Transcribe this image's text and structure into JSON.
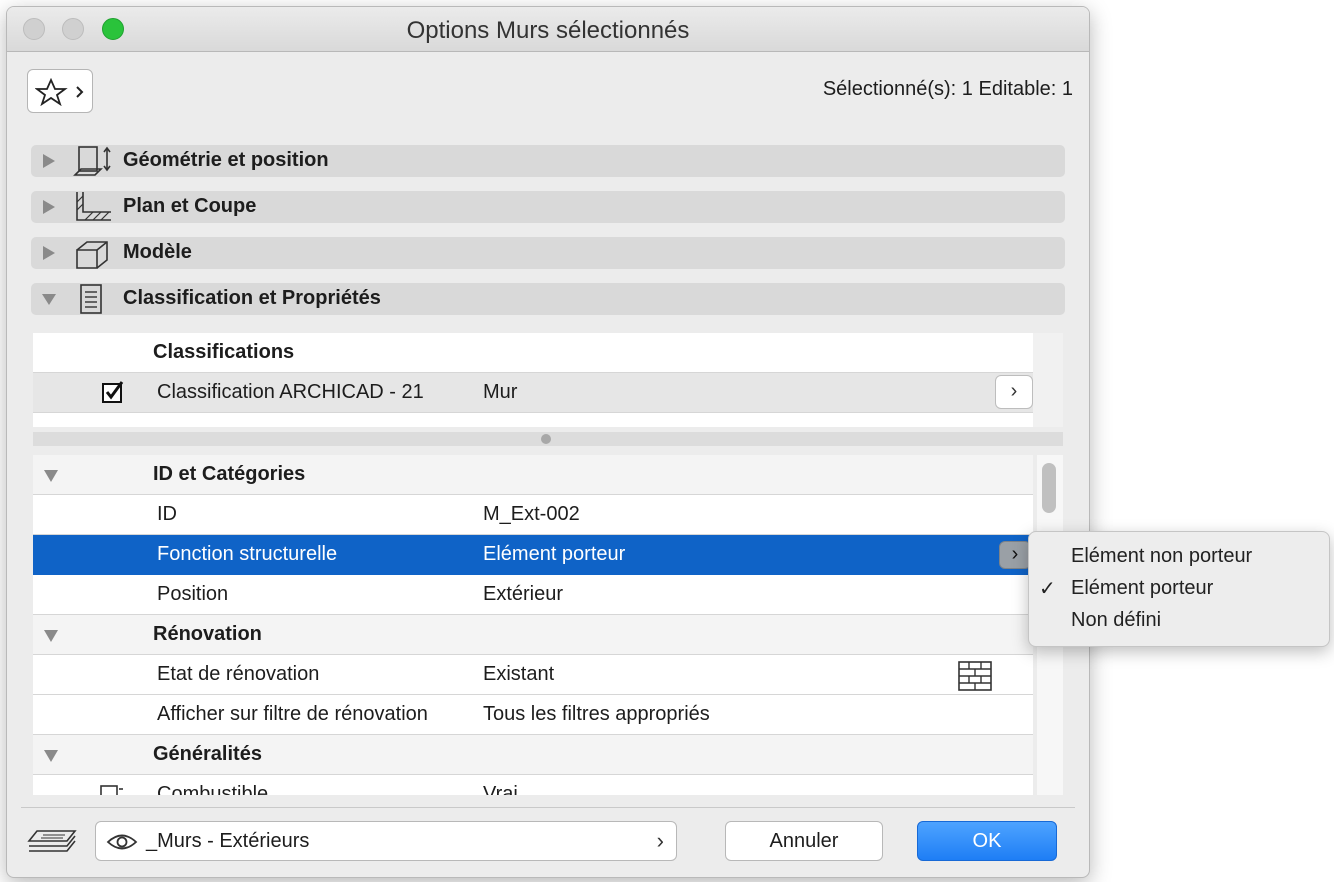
{
  "window": {
    "title": "Options Murs sélectionnés"
  },
  "header": {
    "selection_info": "Sélectionné(s): 1 Editable: 1",
    "favorites_icon": "star-icon"
  },
  "sections": [
    {
      "label": "Géométrie et position",
      "icon": "geometry-icon",
      "expanded": false
    },
    {
      "label": "Plan et Coupe",
      "icon": "floorplan-section-icon",
      "expanded": false
    },
    {
      "label": "Modèle",
      "icon": "model-icon",
      "expanded": false
    },
    {
      "label": "Classification et Propriétés",
      "icon": "document-icon",
      "expanded": true
    }
  ],
  "classifications": {
    "header": "Classifications",
    "rows": [
      {
        "name": "Classification ARCHICAD - 21",
        "value": "Mur",
        "checked": true
      }
    ]
  },
  "properties": {
    "groups": [
      {
        "label": "ID et Catégories",
        "rows": [
          {
            "name": "ID",
            "value": "M_Ext-002"
          },
          {
            "name": "Fonction structurelle",
            "value": "Elément porteur",
            "selected": true
          },
          {
            "name": "Position",
            "value": "Extérieur"
          }
        ]
      },
      {
        "label": "Rénovation",
        "rows": [
          {
            "name": "Etat de rénovation",
            "value": "Existant",
            "icon": "brick-wall-icon"
          },
          {
            "name": "Afficher sur filtre de rénovation",
            "value": "Tous les filtres appropriés"
          }
        ]
      },
      {
        "label": "Généralités",
        "rows": [
          {
            "name": "Combustible",
            "value": "Vrai"
          }
        ]
      }
    ]
  },
  "dropdown": {
    "options": [
      "Elément non porteur",
      "Elément porteur",
      "Non défini"
    ],
    "selected": "Elément porteur",
    "check_mark": "✓"
  },
  "footer": {
    "layer_label": "_Murs - Extérieurs",
    "cancel_label": "Annuler",
    "ok_label": "OK"
  },
  "colors": {
    "selection": "#0f63c7",
    "ok_button": "#1e7ef5",
    "zoom_button": "#2ac33b"
  }
}
